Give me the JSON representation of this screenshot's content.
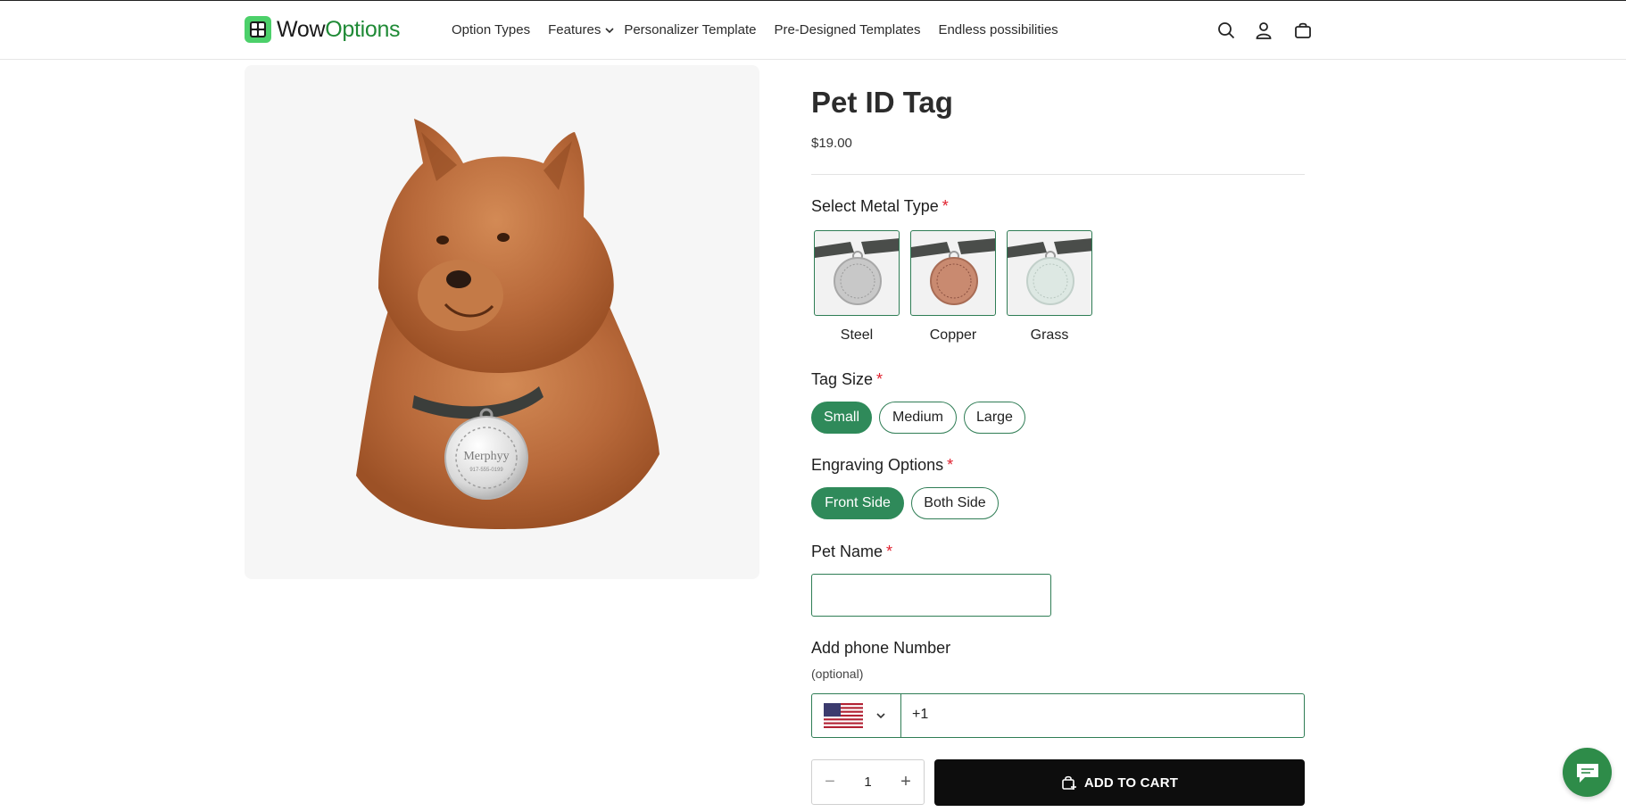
{
  "brand": {
    "wow": "Wow",
    "options": "Options"
  },
  "nav": {
    "items": [
      {
        "label": "Option Types"
      },
      {
        "label": "Features",
        "has_dropdown": true
      },
      {
        "label": "Personalizer Template"
      },
      {
        "label": "Pre-Designed Templates"
      },
      {
        "label": "Endless possibilities"
      }
    ]
  },
  "header_icons": [
    "search-icon",
    "account-icon",
    "cart-icon"
  ],
  "product": {
    "title": "Pet ID Tag",
    "price": "$19.00",
    "tag_text": "Merphyy",
    "tag_phone": "917-555-0199"
  },
  "metal": {
    "label": "Select Metal Type",
    "required_mark": "*",
    "options": [
      {
        "label": "Steel",
        "color": "#c8c8c8"
      },
      {
        "label": "Copper",
        "color": "#c98a70"
      },
      {
        "label": "Grass",
        "color": "#dde8e3"
      }
    ]
  },
  "tag_size": {
    "label": "Tag Size",
    "required_mark": "*",
    "options": [
      "Small",
      "Medium",
      "Large"
    ],
    "selected": "Small"
  },
  "engraving": {
    "label": "Engraving Options",
    "required_mark": "*",
    "options": [
      "Front Side",
      "Both Side"
    ],
    "selected": "Front Side"
  },
  "pet_name": {
    "label": "Pet Name",
    "required_mark": "*",
    "value": ""
  },
  "phone": {
    "label": "Add phone Number",
    "optional": "(optional)",
    "value": "+1",
    "country": "US"
  },
  "quantity": {
    "minus": "−",
    "value": "1",
    "plus": "+"
  },
  "add_to_cart": "ADD TO CART",
  "colors": {
    "accent": "#2f8a5a",
    "brand_green": "#1f8a36",
    "required": "#e0202e",
    "chat": "#2e8c49"
  }
}
